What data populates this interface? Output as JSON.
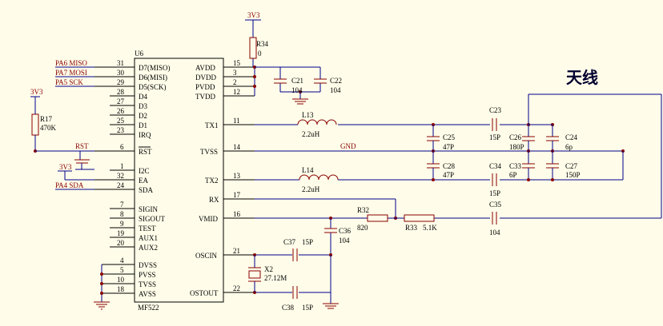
{
  "chip": {
    "ref": "U6",
    "part": "MF522",
    "left_pins": [
      {
        "num": "31",
        "name": "D7(MISO)"
      },
      {
        "num": "30",
        "name": "D6(MISI)"
      },
      {
        "num": "29",
        "name": "D5(SCK)"
      },
      {
        "num": "28",
        "name": "D4"
      },
      {
        "num": "27",
        "name": "D3"
      },
      {
        "num": "26",
        "name": "D2"
      },
      {
        "num": "25",
        "name": "D1"
      },
      {
        "num": "23",
        "name": "IRQ"
      },
      {
        "num": "6",
        "name": "RST"
      },
      {
        "num": "1",
        "name": "I2C"
      },
      {
        "num": "32",
        "name": "EA"
      },
      {
        "num": "24",
        "name": "SDA"
      },
      {
        "num": "7",
        "name": "SIGIN"
      },
      {
        "num": "8",
        "name": "SIGOUT"
      },
      {
        "num": "9",
        "name": "TEST"
      },
      {
        "num": "19",
        "name": "AUX1"
      },
      {
        "num": "20",
        "name": "AUX2"
      },
      {
        "num": "4",
        "name": "DVSS"
      },
      {
        "num": "5",
        "name": "PVSS"
      },
      {
        "num": "10",
        "name": "TVSS"
      },
      {
        "num": "18",
        "name": "AVSS"
      }
    ],
    "right_pins": [
      {
        "num": "15",
        "name": "AVDD"
      },
      {
        "num": "3",
        "name": "DVDD"
      },
      {
        "num": "2",
        "name": "PVDD"
      },
      {
        "num": "12",
        "name": "TVDD"
      },
      {
        "num": "11",
        "name": "TX1"
      },
      {
        "num": "14",
        "name": "TVSS"
      },
      {
        "num": "13",
        "name": "TX2"
      },
      {
        "num": "17",
        "name": "RX"
      },
      {
        "num": "16",
        "name": "VMID"
      },
      {
        "num": "21",
        "name": "OSCIN"
      },
      {
        "num": "22",
        "name": "OSTOUT"
      }
    ]
  },
  "nets": {
    "pa6": "PA6  MISO",
    "pa7": "PA7  MOSI",
    "pa5": "PA5  SCK",
    "pa4": "PA4  SDA",
    "rst": "RST",
    "gnd": "GND",
    "v3v3_a": "3V3",
    "v3v3_b": "3V3",
    "v3v3_c": "3V3"
  },
  "antenna_label": "天线",
  "parts": {
    "r34": {
      "ref": "R34",
      "val": "0"
    },
    "r17": {
      "ref": "R17",
      "val": "470K"
    },
    "r32": {
      "ref": "R32",
      "val": "820"
    },
    "r33": {
      "ref": "R33",
      "val": "5.1K"
    },
    "l13": {
      "ref": "L13",
      "val": "2.2uH"
    },
    "l14": {
      "ref": "L14",
      "val": "2.2uH"
    },
    "x2": {
      "ref": "X2",
      "val": "27.12M"
    },
    "c21": {
      "ref": "C21",
      "val": "104"
    },
    "c22": {
      "ref": "C22",
      "val": "104"
    },
    "c23": {
      "ref": "C23",
      "val": "15P"
    },
    "c24": {
      "ref": "C24",
      "val": "6p"
    },
    "c25": {
      "ref": "C25",
      "val": "47P"
    },
    "c26": {
      "ref": "C26",
      "val": "180P"
    },
    "c27": {
      "ref": "C27",
      "val": "150P"
    },
    "c28": {
      "ref": "C28",
      "val": "47P"
    },
    "c33": {
      "ref": "C33",
      "val": "6P"
    },
    "c34": {
      "ref": "C34",
      "val": "15P"
    },
    "c35": {
      "ref": "C35",
      "val": "104"
    },
    "c36": {
      "ref": "C36",
      "val": "104"
    },
    "c37": {
      "ref": "C37",
      "val": "15P"
    },
    "c38": {
      "ref": "C38",
      "val": "15P"
    }
  }
}
